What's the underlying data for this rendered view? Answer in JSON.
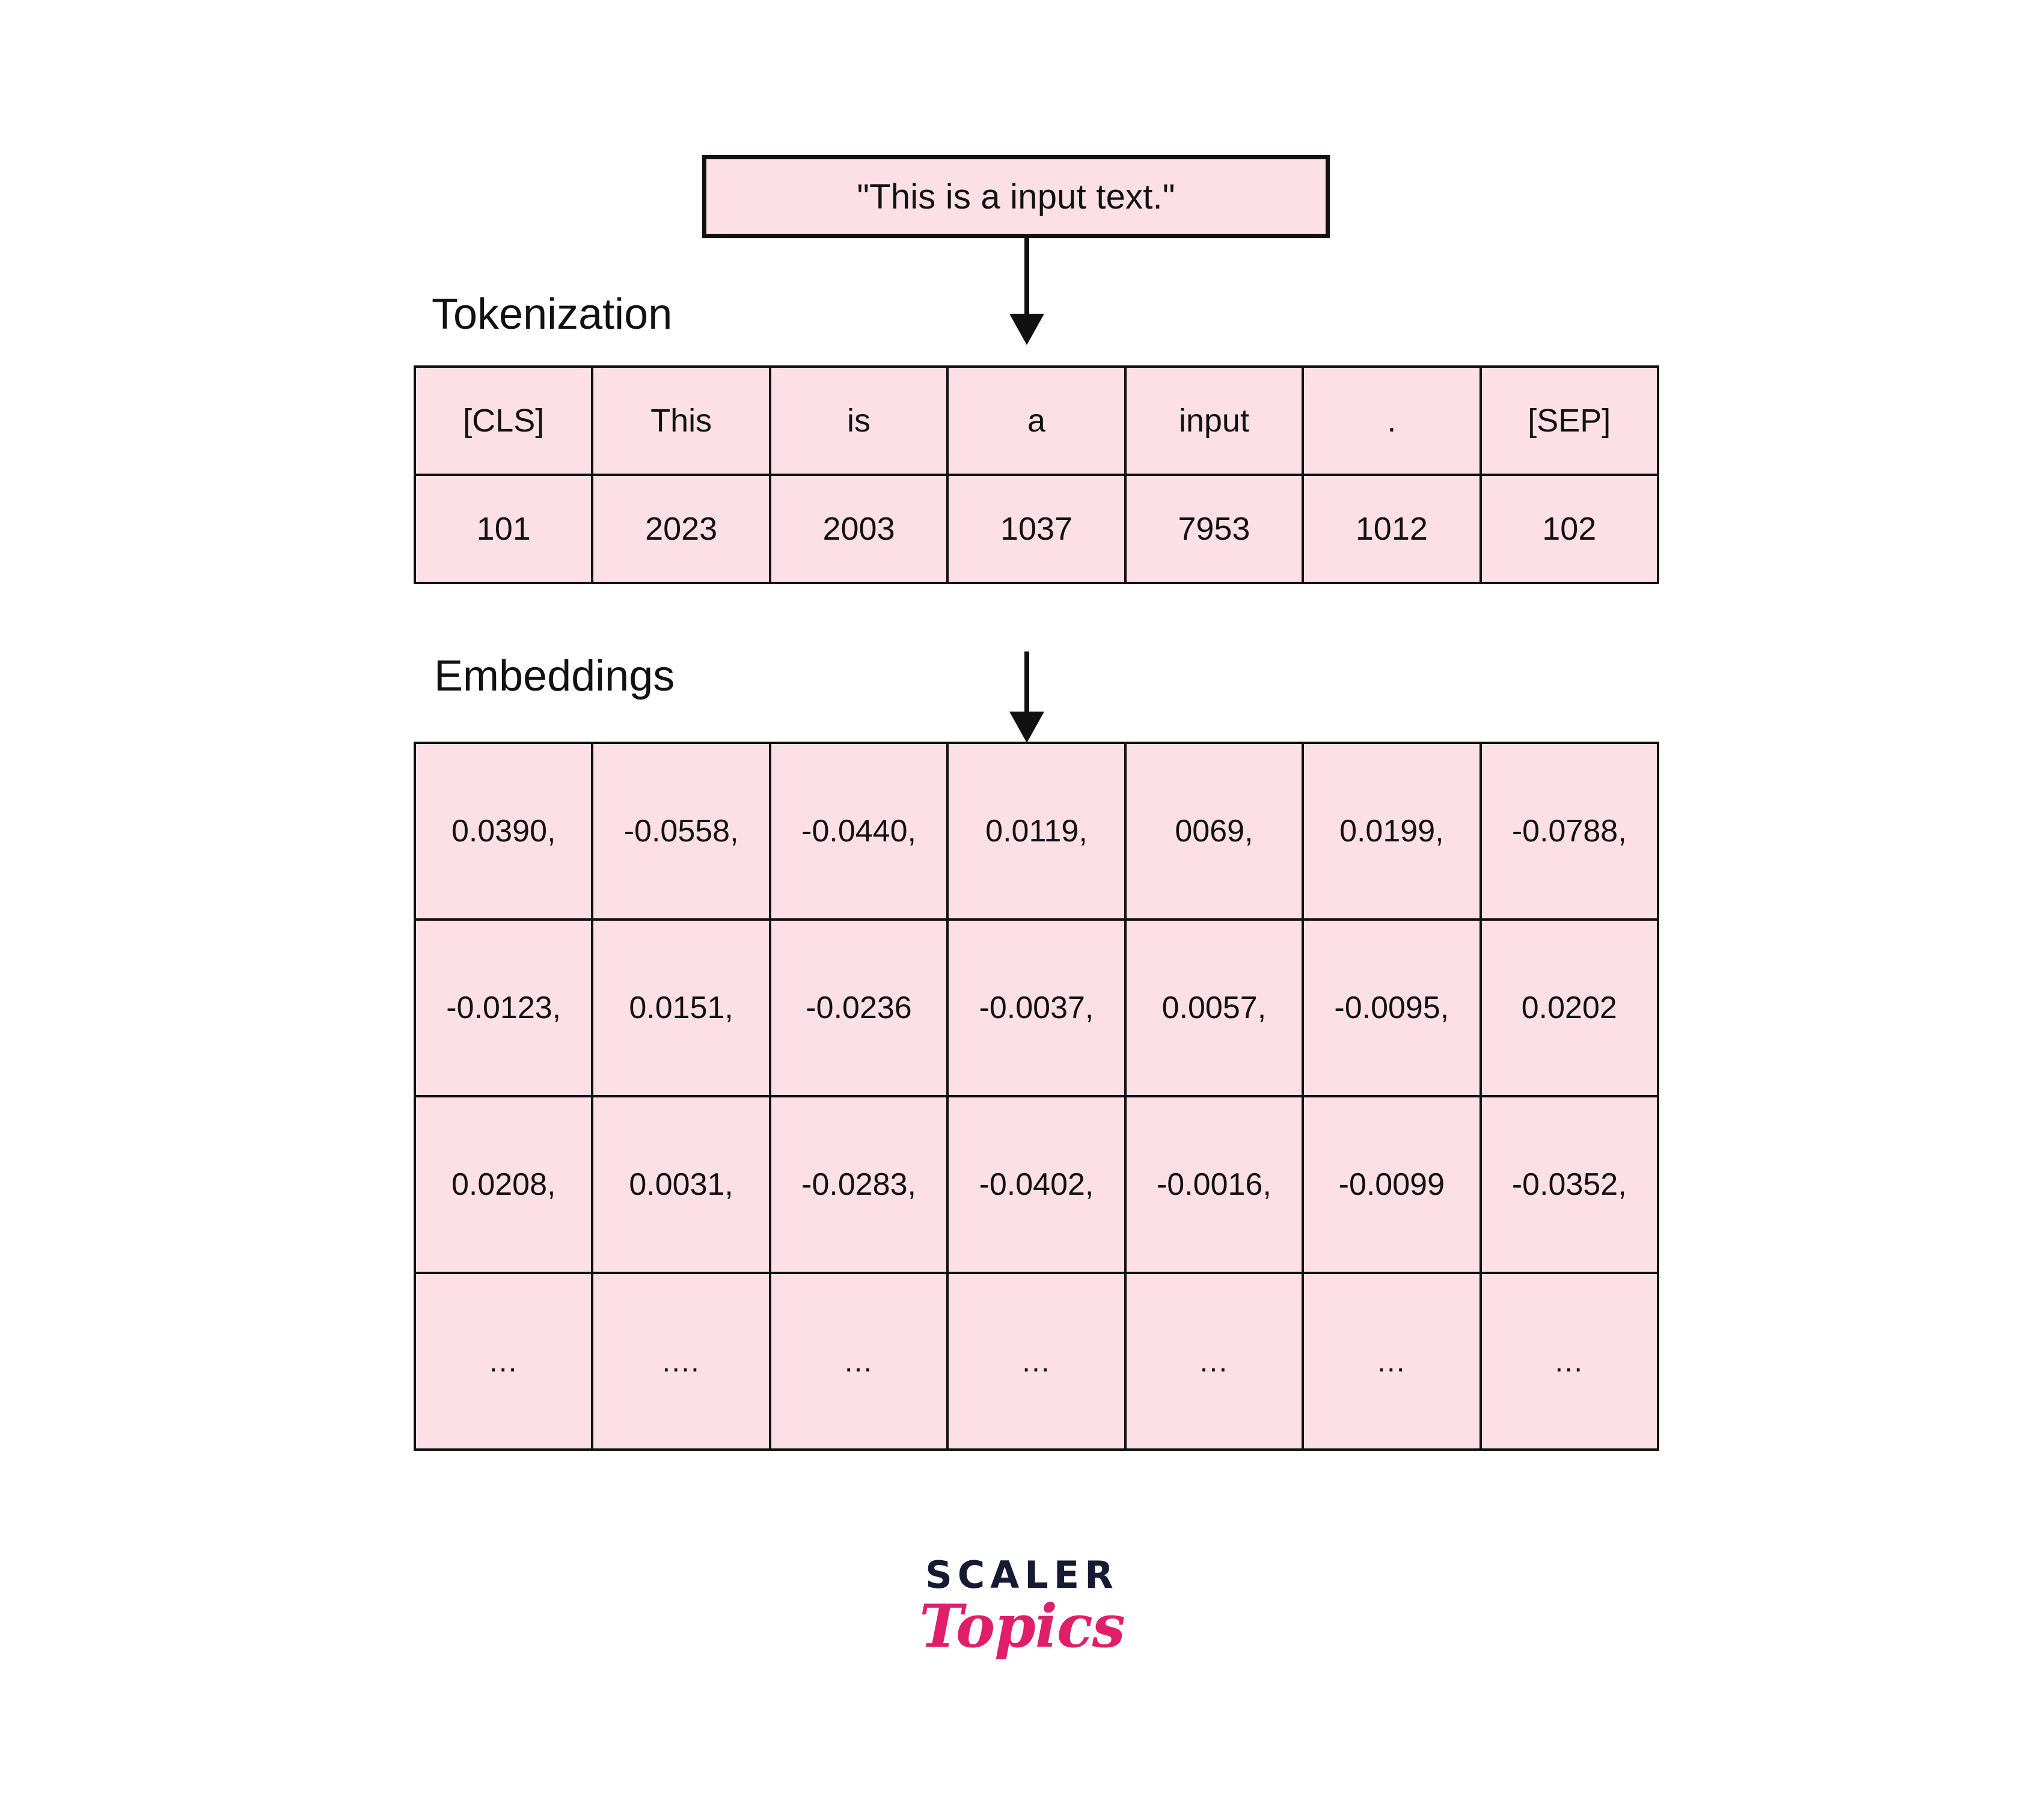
{
  "diagram": {
    "input_box": {
      "text": "\"This is a input text.\""
    },
    "sections": {
      "tokenization_label": "Tokenization",
      "embeddings_label": "Embeddings"
    },
    "tokenization_table": {
      "rows": [
        {
          "name": "tokens",
          "cells": [
            "[CLS]",
            "This",
            "is",
            "a",
            "input",
            ".",
            "[SEP]"
          ]
        },
        {
          "name": "token_ids",
          "cells": [
            "101",
            "2023",
            "2003",
            "1037",
            "7953",
            "1012",
            "102"
          ]
        }
      ]
    },
    "embeddings_table": {
      "rows": [
        {
          "name": "embedding-row-1",
          "cells": [
            "0.0390,",
            "-0.0558,",
            "-0.0440,",
            "0.0119,",
            "0069,",
            "0.0199,",
            "-0.0788,"
          ]
        },
        {
          "name": "embedding-row-2",
          "cells": [
            "-0.0123,",
            "0.0151,",
            "-0.0236",
            "-0.0037,",
            "0.0057,",
            "-0.0095,",
            "0.0202"
          ]
        },
        {
          "name": "embedding-row-3",
          "cells": [
            "0.0208,",
            "0.0031,",
            "-0.0283,",
            "-0.0402,",
            "-0.0016,",
            "-0.0099",
            "-0.0352,"
          ]
        },
        {
          "name": "embedding-row-ellipsis",
          "cells": [
            "...",
            "....",
            "...",
            "...",
            "...",
            "...",
            "..."
          ]
        }
      ]
    },
    "arrows": [
      {
        "name": "arrow-input-to-tokens",
        "direction": "down"
      },
      {
        "name": "arrow-tokens-to-embeddings",
        "direction": "down"
      }
    ],
    "logo": {
      "primary": "SCALER",
      "secondary": "Topics"
    },
    "colors": {
      "cell_fill": "#FCE0E6",
      "border": "#111111",
      "background": "#FFFFFF",
      "logo_primary": "#141B32",
      "logo_secondary": "#E01E6A"
    }
  }
}
